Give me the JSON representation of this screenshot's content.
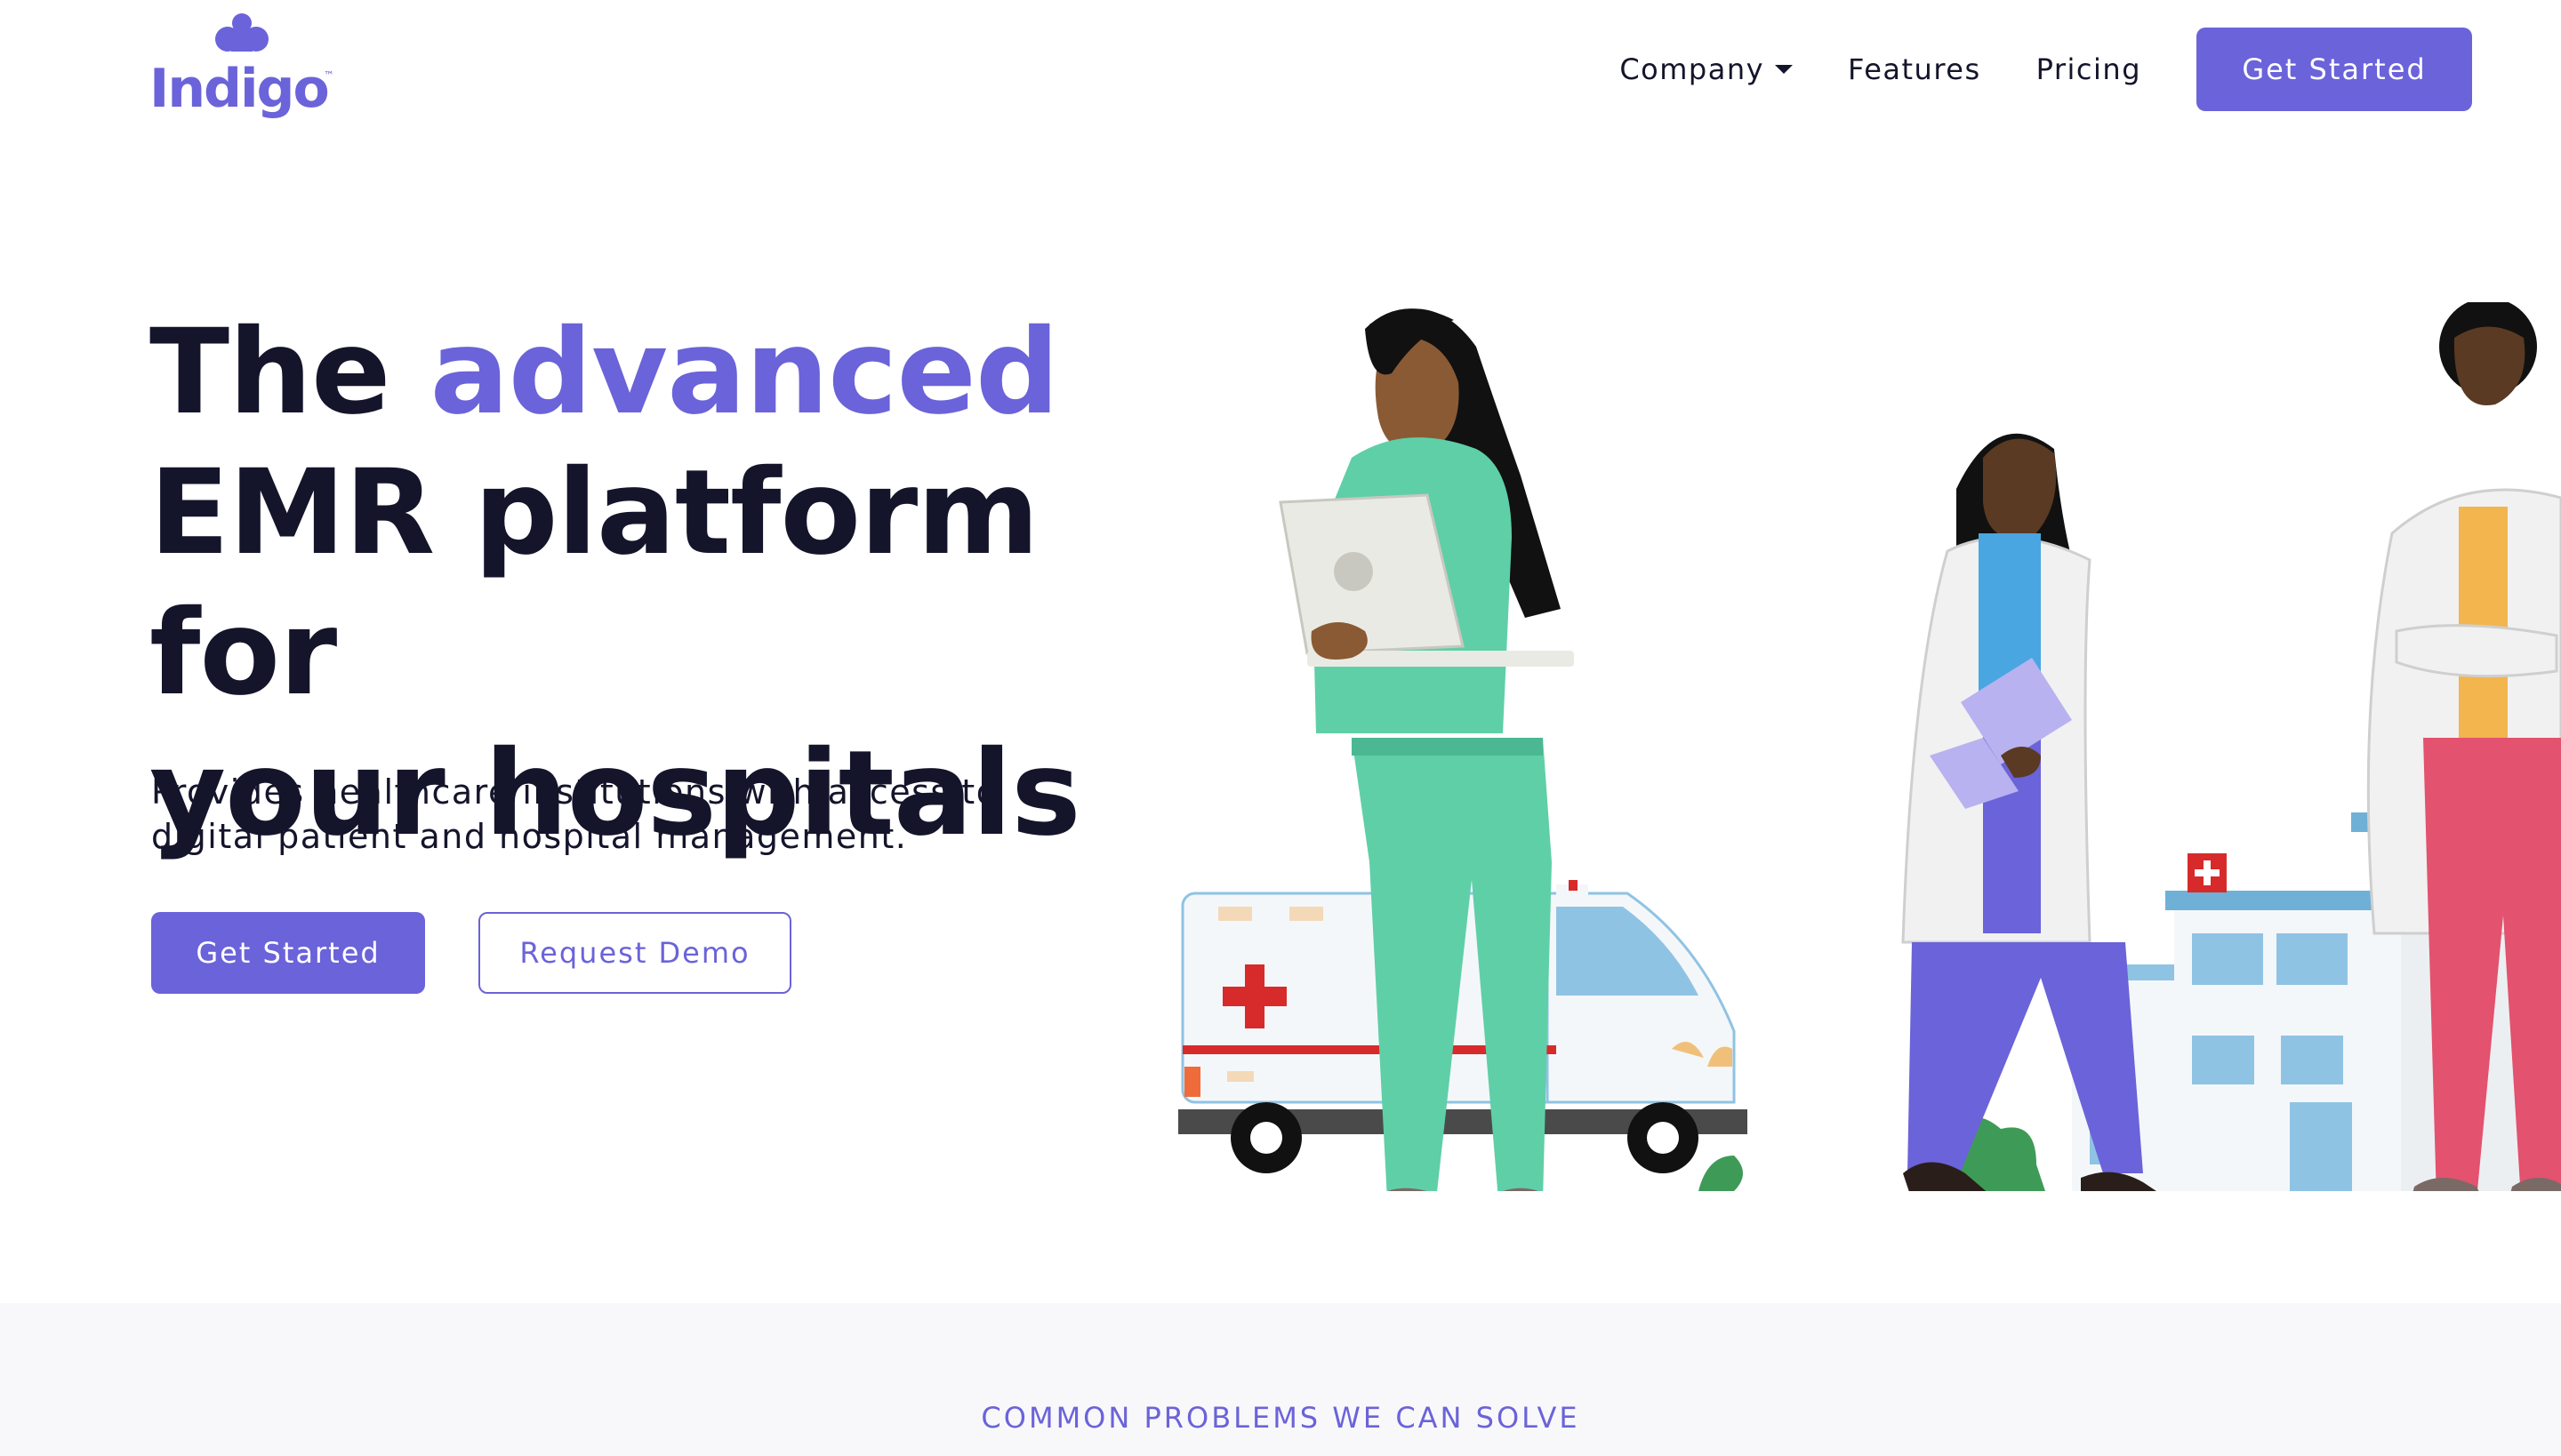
{
  "brand": {
    "name": "Indigo",
    "accent": "#6b63d9",
    "text_color": "#14142b"
  },
  "nav": {
    "items": [
      {
        "label": "Company",
        "has_dropdown": true
      },
      {
        "label": "Features"
      },
      {
        "label": "Pricing"
      }
    ],
    "cta_label": "Get Started"
  },
  "hero": {
    "title_part1": "The ",
    "title_accent": "advanced",
    "title_line2": "EMR platform for",
    "title_line3": "your hospitals",
    "subtitle_line1": "Provides healthcare institutions with access to",
    "subtitle_line2": "digital patient and hospital management.",
    "primary_cta": "Get Started",
    "secondary_cta": "Request Demo"
  },
  "section": {
    "label": "COMMON PROBLEMS WE CAN SOLVE"
  },
  "icons": [
    "indigo-logo-icon",
    "chevron-down-icon"
  ]
}
